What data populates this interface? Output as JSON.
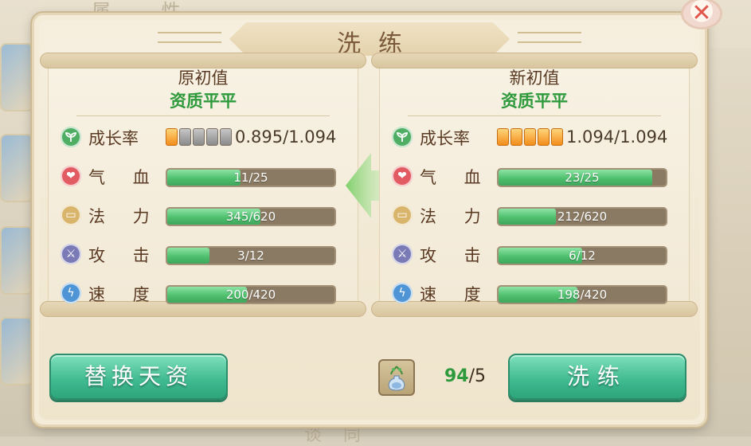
{
  "background": {
    "top_text": "属 性",
    "bottom_text": "谈 同"
  },
  "dialog": {
    "title": "洗练",
    "close_label": "✕"
  },
  "left_panel": {
    "title": "原初值",
    "grade": "资质平平",
    "growth": {
      "label": "成长率",
      "value": "0.895/1.094",
      "pips_on": 1,
      "pips_total": 5
    },
    "stats": [
      {
        "label": "气 血",
        "value": "11/25",
        "current": 11,
        "max": 25,
        "icon": "heart-icon"
      },
      {
        "label": "法 力",
        "value": "345/620",
        "current": 345,
        "max": 620,
        "icon": "scroll-icon"
      },
      {
        "label": "攻 击",
        "value": "3/12",
        "current": 3,
        "max": 12,
        "icon": "sword-icon"
      },
      {
        "label": "速 度",
        "value": "200/420",
        "current": 200,
        "max": 420,
        "icon": "lightning-icon"
      }
    ]
  },
  "right_panel": {
    "title": "新初值",
    "grade": "资质平平",
    "growth": {
      "label": "成长率",
      "value": "1.094/1.094",
      "pips_on": 5,
      "pips_total": 5
    },
    "stats": [
      {
        "label": "气 血",
        "value": "23/25",
        "current": 23,
        "max": 25,
        "icon": "heart-icon"
      },
      {
        "label": "法 力",
        "value": "212/620",
        "current": 212,
        "max": 620,
        "icon": "scroll-icon"
      },
      {
        "label": "攻 击",
        "value": "6/12",
        "current": 6,
        "max": 12,
        "icon": "sword-icon"
      },
      {
        "label": "速 度",
        "value": "198/420",
        "current": 198,
        "max": 420,
        "icon": "lightning-icon"
      }
    ]
  },
  "footer": {
    "replace_button": "替换天资",
    "refine_button": "洗练",
    "item_icon": "potion-vase-icon",
    "item_have": "94",
    "item_need": "5"
  },
  "colors": {
    "accent_green": "#3fb98f",
    "grade_green": "#2e9a3c",
    "bar_fill": "#4fbf6e",
    "bar_track": "#8b7a63"
  }
}
